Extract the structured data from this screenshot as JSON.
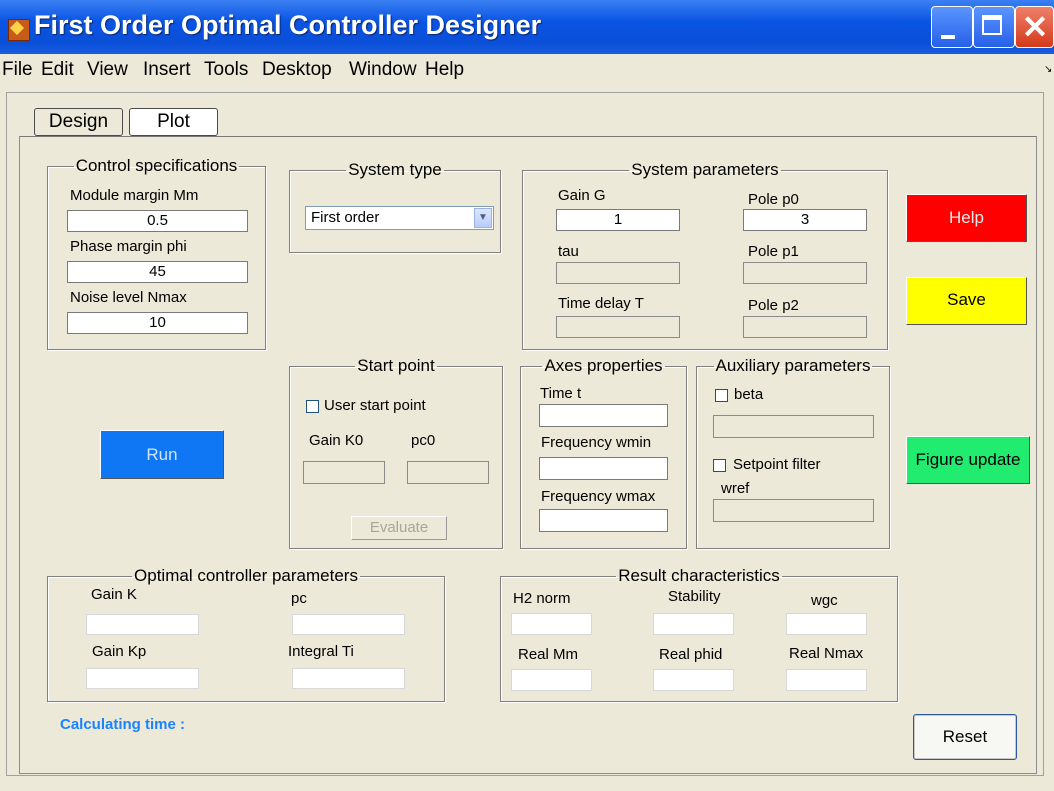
{
  "window": {
    "title": "First Order Optimal Controller Designer",
    "controls": {
      "close_glyph": "✕"
    }
  },
  "menu": [
    "File",
    "Edit",
    "View",
    "Insert",
    "Tools",
    "Desktop",
    "Window",
    "Help"
  ],
  "tabs": [
    "Design",
    "Plot"
  ],
  "control_specs": {
    "title": "Control specifications",
    "mm_label": "Module margin Mm",
    "mm_value": "0.5",
    "phi_label": "Phase margin phi",
    "phi_value": "45",
    "nmax_label": "Noise level Nmax",
    "nmax_value": "10"
  },
  "system_type": {
    "title": "System type",
    "selected": "First order"
  },
  "system_params": {
    "title": "System parameters",
    "gain_label": "Gain G",
    "gain_value": "1",
    "p0_label": "Pole p0",
    "p0_value": "3",
    "tau_label": "tau",
    "p1_label": "Pole p1",
    "delay_label": "Time delay T",
    "p2_label": "Pole p2"
  },
  "start_point": {
    "title": "Start point",
    "checkbox_label": "User start point",
    "k0_label": "Gain K0",
    "pc0_label": "pc0",
    "evaluate_label": "Evaluate"
  },
  "axes": {
    "title": "Axes properties",
    "time_label": "Time t",
    "wmin_label": "Frequency wmin",
    "wmax_label": "Frequency wmax"
  },
  "aux": {
    "title": "Auxiliary parameters",
    "beta_label": "beta",
    "setpoint_label": "Setpoint filter",
    "wref_label": "wref"
  },
  "optimal": {
    "title": "Optimal controller parameters",
    "k_label": "Gain K",
    "pc_label": "pc",
    "kp_label": "Gain Kp",
    "ti_label": "Integral Ti"
  },
  "results": {
    "title": "Result characteristics",
    "h2_label": "H2 norm",
    "stability_label": "Stability",
    "wgc_label": "wgc",
    "mm_label": "Real Mm",
    "phid_label": "Real phid",
    "nmax_label": "Real Nmax"
  },
  "buttons": {
    "help": "Help",
    "save": "Save",
    "figure_update": "Figure update",
    "run": "Run",
    "reset": "Reset"
  },
  "calc_time_label": "Calculating time :",
  "colors": {
    "help": "#ff0000",
    "save": "#ffff00",
    "figure_update": "#22ec70",
    "run": "#0f77f4",
    "calc_text": "#1a83ff"
  }
}
